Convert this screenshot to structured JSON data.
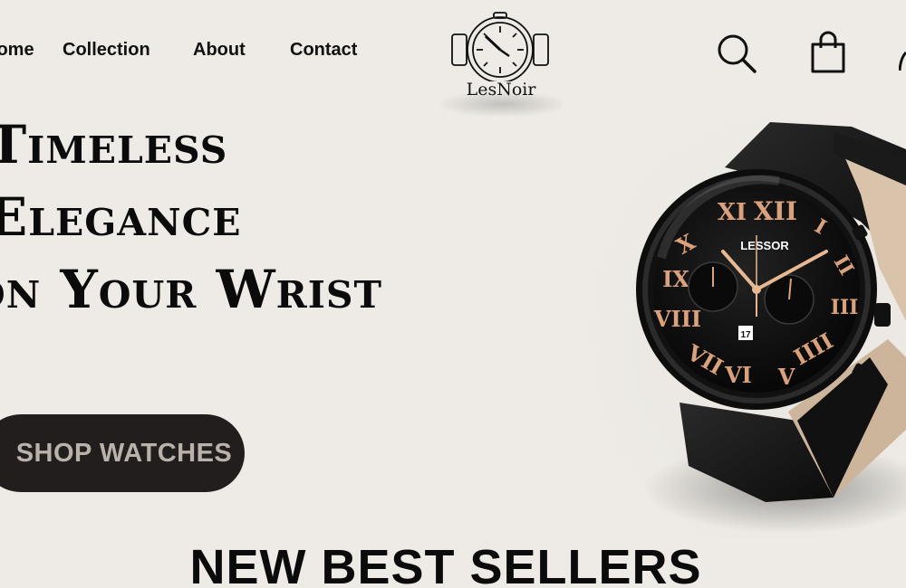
{
  "nav": {
    "links": [
      "Home",
      "Collection",
      "About",
      "Contact"
    ]
  },
  "brand": {
    "name": "LesNoir"
  },
  "header_icons": [
    "search-icon",
    "shopping-bag-icon",
    "user-icon"
  ],
  "hero": {
    "line1": "Timeless",
    "line2": "Elegance",
    "line3": "on Your Wrist",
    "cta_label": "SHOP WATCHES"
  },
  "product_image": {
    "watch_brand": "LESSOR",
    "date_window": "17"
  },
  "section": {
    "title": "NEW BEST SELLERS"
  },
  "colors": {
    "background": "#eeebe6",
    "cta_background": "#221e1d",
    "cta_text": "#b9b2aa",
    "accent_rose_gold": "#d9a27c"
  }
}
